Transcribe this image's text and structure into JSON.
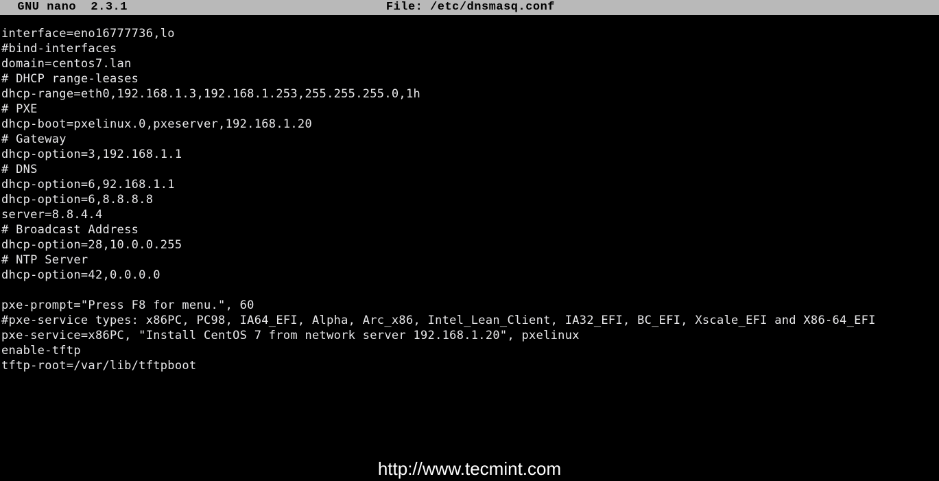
{
  "header": {
    "appLabel": "  GNU nano  2.3.1",
    "fileLabel": "File: /etc/dnsmasq.conf"
  },
  "lines": [
    "interface=eno16777736,lo",
    "#bind-interfaces",
    "domain=centos7.lan",
    "# DHCP range-leases",
    "dhcp-range=eth0,192.168.1.3,192.168.1.253,255.255.255.0,1h",
    "# PXE",
    "dhcp-boot=pxelinux.0,pxeserver,192.168.1.20",
    "# Gateway",
    "dhcp-option=3,192.168.1.1",
    "# DNS",
    "dhcp-option=6,92.168.1.1",
    "dhcp-option=6,8.8.8.8",
    "server=8.8.4.4",
    "# Broadcast Address",
    "dhcp-option=28,10.0.0.255",
    "# NTP Server",
    "dhcp-option=42,0.0.0.0",
    "",
    "pxe-prompt=\"Press F8 for menu.\", 60",
    "#pxe-service types: x86PC, PC98, IA64_EFI, Alpha, Arc_x86, Intel_Lean_Client, IA32_EFI, BC_EFI, Xscale_EFI and X86-64_EFI",
    "pxe-service=x86PC, \"Install CentOS 7 from network server 192.168.1.20\", pxelinux",
    "enable-tftp",
    "tftp-root=/var/lib/tftpboot"
  ],
  "watermark": "http://www.tecmint.com"
}
